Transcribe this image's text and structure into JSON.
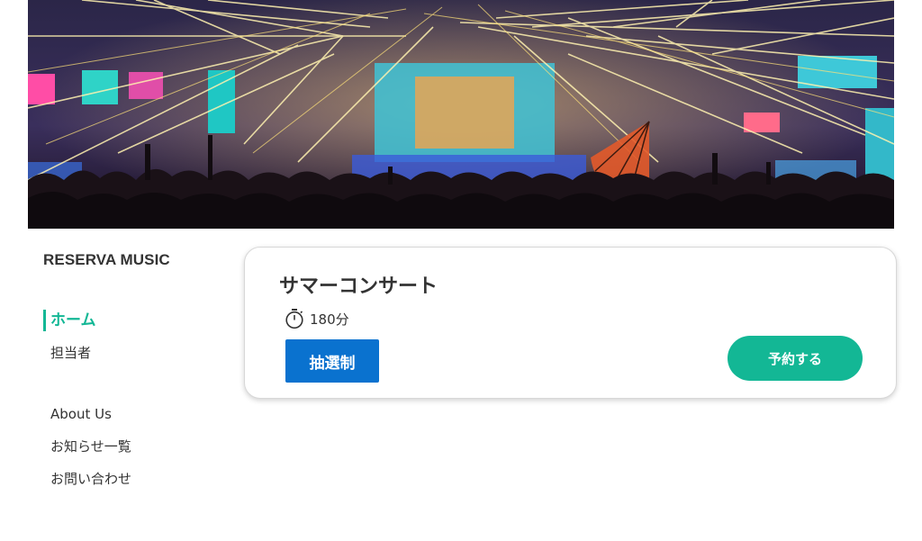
{
  "header": {
    "hero_image": "concert-stage-laser-lights-crowd"
  },
  "brand": {
    "name": "RESERVA MUSIC"
  },
  "nav": {
    "primary": [
      {
        "label": "ホーム",
        "active": true
      },
      {
        "label": "担当者",
        "active": false
      }
    ],
    "secondary": [
      {
        "label": "About Us"
      },
      {
        "label": "お知らせ一覧"
      },
      {
        "label": "お問い合わせ"
      }
    ]
  },
  "event": {
    "title": "サマーコンサート",
    "duration": "180分",
    "duration_icon": "stopwatch-icon",
    "badge": "抽選制",
    "reserve_label": "予約する"
  },
  "colors": {
    "accent": "#13b795",
    "badge": "#0a72cf",
    "text": "#333333"
  }
}
